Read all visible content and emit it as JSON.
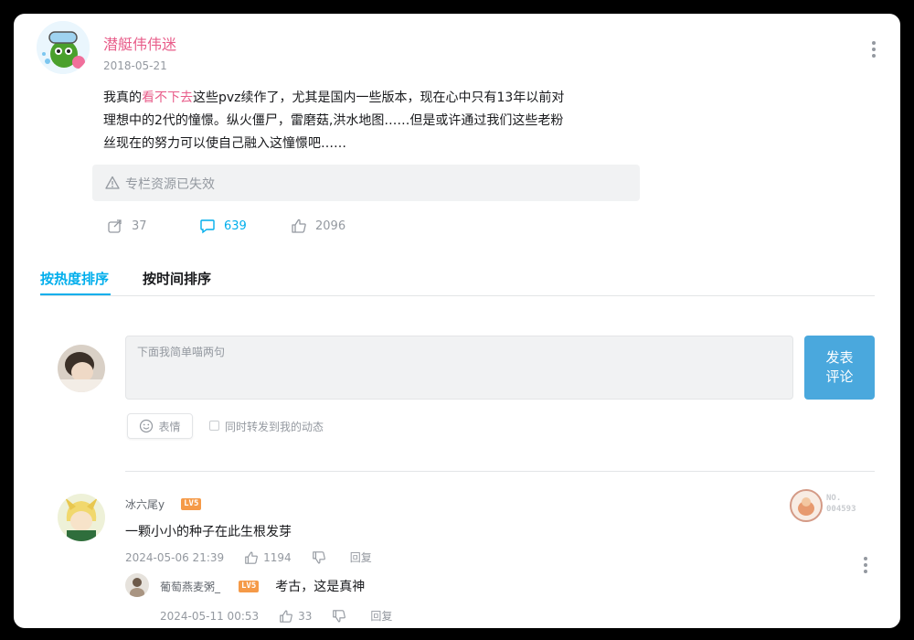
{
  "post": {
    "author": "潜艇伟伟迷",
    "date": "2018-05-21",
    "text_before": "我真的",
    "text_highlight": "看不下去",
    "text_after": "这些pvz续作了，尤其是国内一些版本，现在心中只有13年以前对理想中的2代的憧憬。纵火僵尸，雷磨菇,洪水地图……但是或许通过我们这些老粉丝现在的努力可以使自己融入这憧憬吧……",
    "line1_after": "这些pvz续作了，尤其是国内一些版本，现在心中只有13年以前对",
    "line2": "理想中的2代的憧憬。纵火僵尸，雷磨菇,洪水地图……但是或许通过我们这些老粉",
    "line3": "丝现在的努力可以使自己融入这憧憬吧……",
    "invalid_notice": "专栏资源已失效",
    "share_count": "37",
    "comment_count": "639",
    "like_count": "2096"
  },
  "tabs": {
    "hot": "按热度排序",
    "time": "按时间排序"
  },
  "composer": {
    "placeholder": "下面我简单喵两句",
    "publish_line1": "发表",
    "publish_line2": "评论",
    "emoji_label": "表情",
    "forward_label": "同时转发到我的动态"
  },
  "comments": [
    {
      "user": "冰六尾y",
      "level": "LV5",
      "text": "一颗小小的种子在此生根发芽",
      "time": "2024-05-06 21:39",
      "likes": "1194",
      "reply_label": "回复",
      "badge_no": "NO.",
      "badge_num": "004593",
      "replies": [
        {
          "user": "葡萄燕麦粥_",
          "level": "LV5",
          "text": "考古，这是真神",
          "time": "2024-05-11 00:53",
          "likes": "33",
          "reply_label": "回复"
        }
      ]
    }
  ],
  "colors": {
    "accent": "#00aeec",
    "author_pink": "#e85d8a",
    "publish_bg": "#4aa8dd",
    "muted": "#9499a0"
  }
}
